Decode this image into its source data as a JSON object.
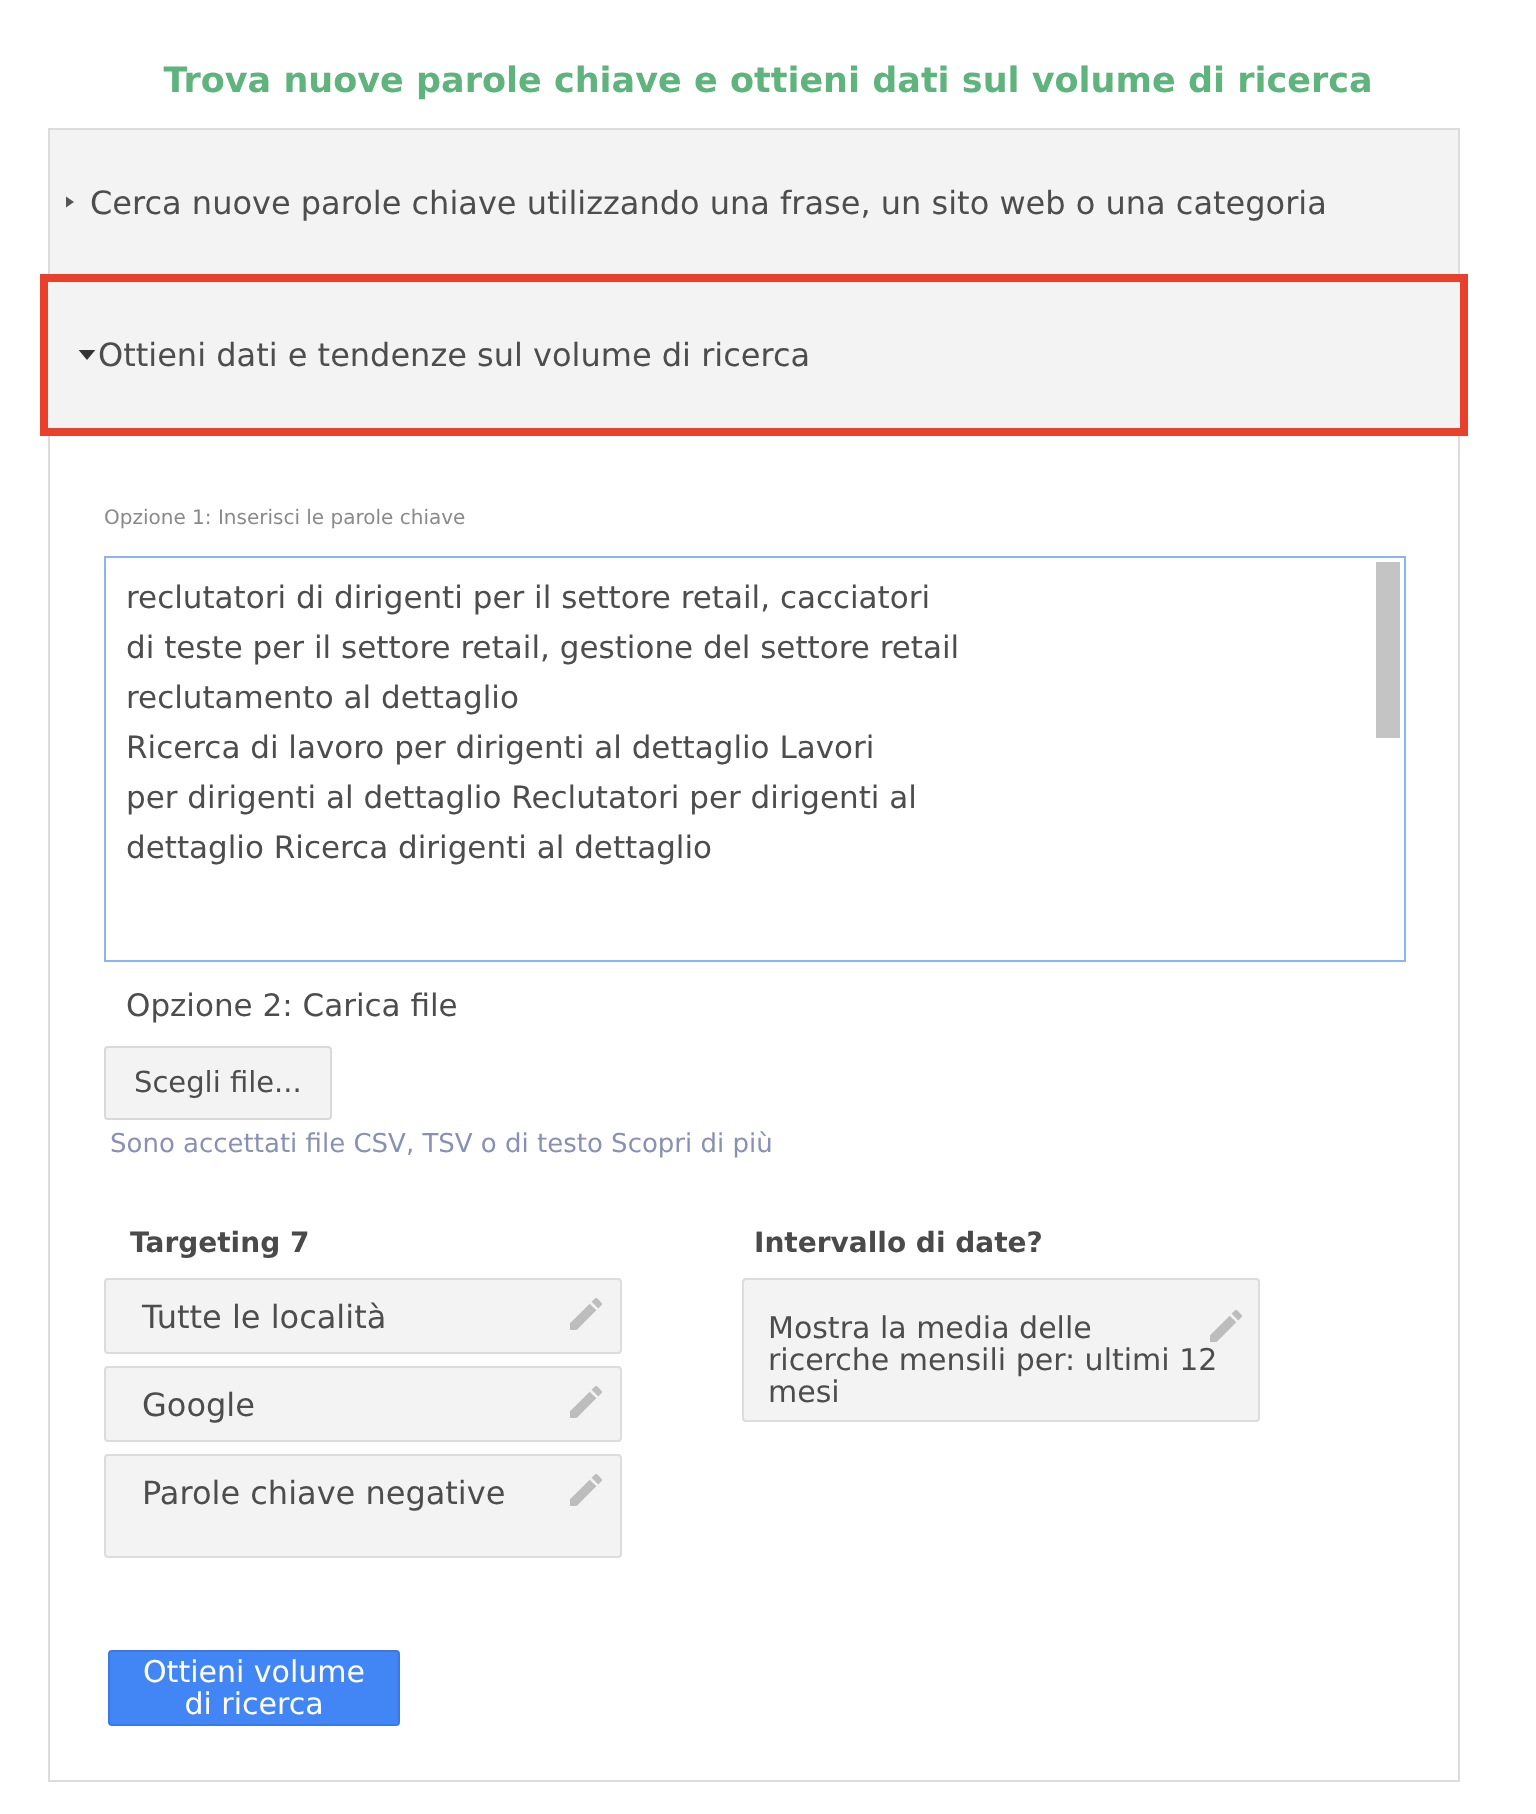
{
  "title": "Trova nuove parole chiave e ottieni dati sul volume di ricerca",
  "sections": [
    {
      "title": "Cerca nuove parole chiave utilizzando una frase, un sito web o una categoria",
      "expanded": false,
      "highlighted": false
    },
    {
      "title": "Ottieni dati e tendenze sul volume di ricerca",
      "expanded": true,
      "highlighted": true,
      "content": {
        "keyword_option": {
          "label": "Opzione 1: Inserisci le parole chiave",
          "value": "reclutatori di dirigenti per il settore retail, cacciatori\ndi teste per il settore retail, gestione del settore retail\nreclutamento al dettaglio\nRicerca di lavoro per dirigenti al dettaglio Lavori\nper dirigenti al dettaglio Reclutatori per dirigenti al\ndettaglio Ricerca dirigenti al dettaglio"
        },
        "file_option": {
          "label": "Opzione 2: Carica file",
          "button": "Scegli file...",
          "help": "Sono accettati file CSV, TSV o di testo Scopri di più"
        },
        "targeting": {
          "heading": "Targeting 7",
          "items": [
            "Tutte le località",
            "Google",
            "Parole chiave negative"
          ]
        },
        "date_range": {
          "heading": "Intervallo di date?",
          "value": "Mostra la media delle ricerche mensili per: ultimi 12 mesi"
        },
        "submit_button": "Ottieni volume di ricerca"
      }
    }
  ]
}
